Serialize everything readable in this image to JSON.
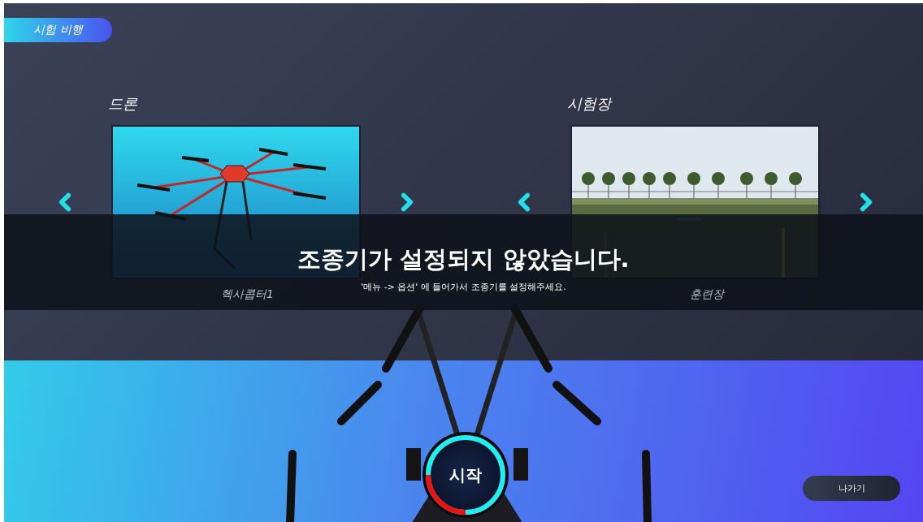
{
  "header": {
    "title": "시험 비행"
  },
  "selectors": [
    {
      "kind": "drone",
      "label": "드론",
      "caption": "헥사콥터1"
    },
    {
      "kind": "field",
      "label": "시험장",
      "caption": "훈련장"
    }
  ],
  "notice": {
    "title": "조종기가 설정되지 않았습니다.",
    "message": "'메뉴 -> 옵션' 에 들어가서 조종기를 설정해주세요."
  },
  "start_button": {
    "label": "시작"
  },
  "exit_button": {
    "label": "나가기"
  }
}
